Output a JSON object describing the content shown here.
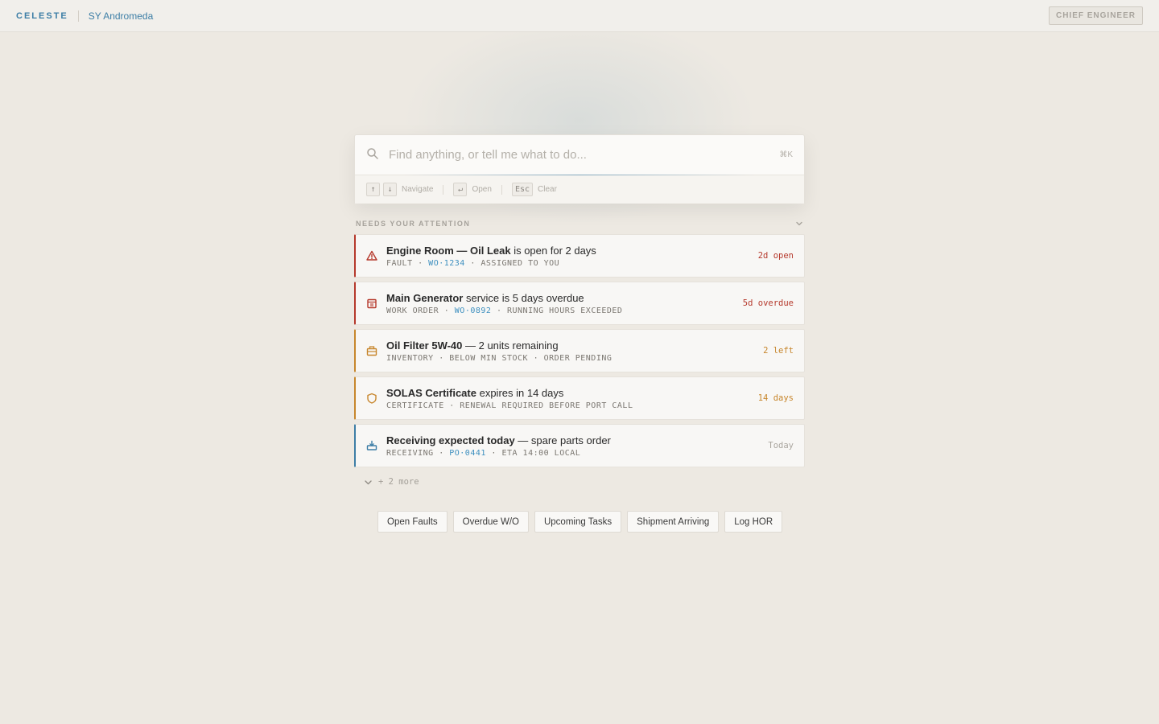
{
  "topbar": {
    "brand": "CELESTE",
    "vessel": "SY Andromeda",
    "role": "CHIEF ENGINEER"
  },
  "search": {
    "placeholder": "Find anything, or tell me what to do...",
    "shortcut": "⌘K",
    "hints": {
      "navigate": "Navigate",
      "open": "Open",
      "clear": "Clear",
      "key_up": "↑",
      "key_down": "↓",
      "key_enter": "↵",
      "key_esc": "Esc"
    }
  },
  "attention": {
    "title": "NEEDS YOUR ATTENTION",
    "items": [
      {
        "icon": "warning-triangle-icon",
        "severity": "red",
        "title_bold": "Engine Room — Oil Leak",
        "title_rest": " is open for 2 days",
        "meta_prefix": "FAULT · ",
        "meta_ref": "WO·1234",
        "meta_suffix": " · ASSIGNED TO YOU",
        "status": "2d open"
      },
      {
        "icon": "calendar-icon",
        "severity": "red",
        "title_bold": "Main Generator",
        "title_rest": " service is 5 days overdue",
        "meta_prefix": "WORK ORDER · ",
        "meta_ref": "WO·0892",
        "meta_suffix": " · RUNNING HOURS EXCEEDED",
        "status": "5d overdue"
      },
      {
        "icon": "box-icon",
        "severity": "amber",
        "title_bold": "Oil Filter 5W-40",
        "title_rest": " — 2 units remaining",
        "meta_prefix": "INVENTORY · BELOW MIN STOCK · ORDER PENDING",
        "meta_ref": "",
        "meta_suffix": "",
        "status": "2 left"
      },
      {
        "icon": "shield-icon",
        "severity": "amber",
        "title_bold": "SOLAS Certificate",
        "title_rest": " expires in 14 days",
        "meta_prefix": "CERTIFICATE · RENEWAL REQUIRED BEFORE PORT CALL",
        "meta_ref": "",
        "meta_suffix": "",
        "status": "14 days"
      },
      {
        "icon": "inbox-icon",
        "severity": "blue",
        "title_bold": "Receiving expected today",
        "title_rest": " — spare parts order",
        "meta_prefix": "RECEIVING · ",
        "meta_ref": "PO·0441",
        "meta_suffix": " · ETA 14:00 LOCAL",
        "status": "Today"
      }
    ],
    "more": "+ 2 more"
  },
  "quick_actions": [
    "Open Faults",
    "Overdue W/O",
    "Upcoming Tasks",
    "Shipment Arriving",
    "Log HOR"
  ],
  "colors": {
    "accent": "#3d7ea6",
    "danger": "#b5382b",
    "warning": "#c7862c",
    "background": "#ede9e2"
  }
}
